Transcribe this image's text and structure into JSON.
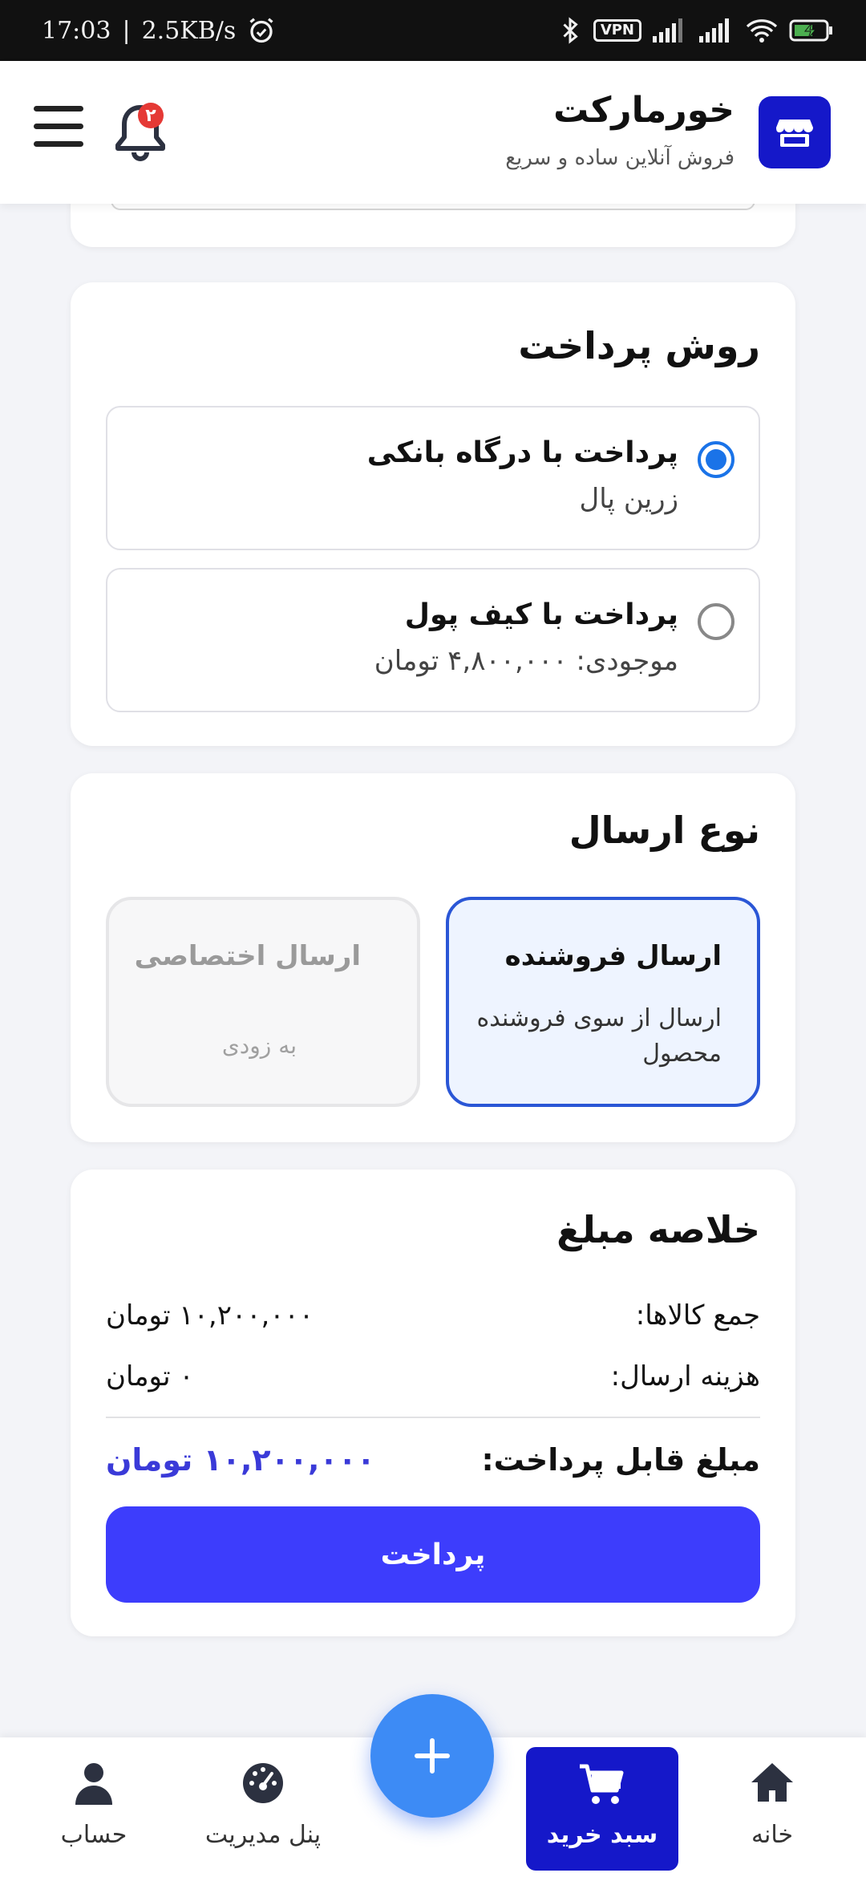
{
  "status_bar": {
    "time": "17:03",
    "network_speed": "2.5KB/s",
    "vpn_label": "VPN"
  },
  "header": {
    "brand_title": "خورمارکت",
    "brand_subtitle": "فروش آنلاین ساده و سریع",
    "notification_count": "۲"
  },
  "payment": {
    "title": "روش پرداخت",
    "options": [
      {
        "label": "پرداخت با درگاه بانکی",
        "sub": "زرین پال",
        "selected": true
      },
      {
        "label": "پرداخت با کیف پول",
        "sub": "موجودی: ۴,۸۰۰,۰۰۰ تومان",
        "selected": false
      }
    ]
  },
  "shipping": {
    "title": "نوع ارسال",
    "options": [
      {
        "label": "ارسال فروشنده",
        "sub": "ارسال از سوی فروشنده محصول",
        "selected": true
      },
      {
        "label": "ارسال اختصاصی",
        "sub": "به زودی",
        "disabled": true
      }
    ]
  },
  "summary": {
    "title": "خلاصه مبلغ",
    "items_label": "جمع کالاها:",
    "items_value": "۱۰,۲۰۰,۰۰۰ تومان",
    "shipping_label": "هزینه ارسال:",
    "shipping_value": "۰ تومان",
    "total_label": "مبلغ قابل پرداخت:",
    "total_value": "۱۰,۲۰۰,۰۰۰ تومان",
    "pay_button": "پرداخت"
  },
  "bottom_nav": {
    "home": "خانه",
    "cart": "سبد خرید",
    "panel": "پنل مدیریت",
    "account": "حساب",
    "fab_icon": "plus-icon"
  },
  "colors": {
    "brand": "#1518c9",
    "accent": "#3d3dfc",
    "radio": "#1a73e8",
    "fab": "#3d8bf5",
    "total": "#3a3ad8"
  }
}
